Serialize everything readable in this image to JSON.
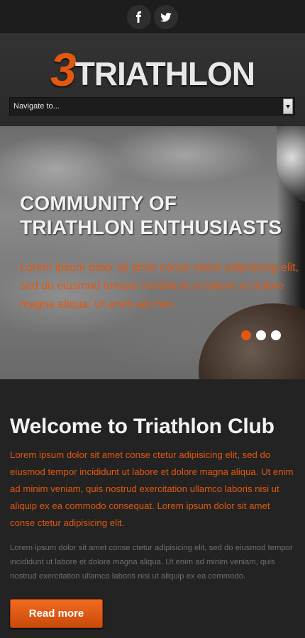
{
  "social": {
    "facebook_icon": "facebook-icon",
    "twitter_icon": "twitter-icon"
  },
  "logo": {
    "number": "3",
    "text": "TRIATHLON"
  },
  "nav": {
    "selected": "Navigate to..."
  },
  "hero": {
    "title_line1": "COMMUNITY OF",
    "title_line2": "TRIATHLON ENTHUSIASTS",
    "text": "Lorem ipsum dolor sit amet conse ctetur adipisicing elit, sed do eiusmod tempor incididunt ut labore et dolore magna aliqua. Ut enim ad mini.",
    "slides": 3,
    "active_slide": 1
  },
  "main": {
    "title": "Welcome to Triathlon Club",
    "lead": "Lorem ipsum dolor sit amet conse ctetur adipisicing elit, sed do eiusmod tempor incididunt ut labore et dolore magna aliqua. Ut enim ad minim veniam, quis nostrud exercitation ullamco laboris nisi ut aliquip ex ea commodo consequat. Lorem ipsum dolor sit amet conse ctetur adipisicing elit.",
    "body": "Lorem ipsum dolor sit amet conse ctetur adipisicing elit, sed do eiusmod tempor incididunt ut labore et dolore magna aliqua. Ut enim ad minim veniam, quis nostrud exercitation ullamco laboris nisi ut aliquip ex ea commodo.",
    "button_label": "Read more"
  },
  "colors": {
    "accent": "#e2580f",
    "background": "#232323"
  }
}
